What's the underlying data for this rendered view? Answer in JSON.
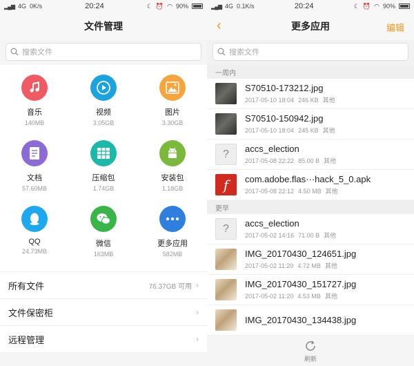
{
  "left": {
    "status": {
      "net": "4G",
      "speed": "0K/s",
      "time": "20:24",
      "battery": "90%"
    },
    "title": "文件管理",
    "search_placeholder": "搜索文件",
    "categories": [
      {
        "name": "音乐",
        "size": "140MB",
        "color": "#ef5a63",
        "icon": "music-icon"
      },
      {
        "name": "视频",
        "size": "3.05GB",
        "color": "#1ba3e0",
        "icon": "play-icon"
      },
      {
        "name": "图片",
        "size": "3.30GB",
        "color": "#f5a53c",
        "icon": "image-icon"
      },
      {
        "name": "文档",
        "size": "57.60MB",
        "color": "#8c6bd6",
        "icon": "document-icon"
      },
      {
        "name": "压缩包",
        "size": "1.74GB",
        "color": "#1cb8aa",
        "icon": "archive-icon"
      },
      {
        "name": "安装包",
        "size": "1.18GB",
        "color": "#7ab93c",
        "icon": "android-icon"
      },
      {
        "name": "QQ",
        "size": "24.73MB",
        "color": "#1ea8f0",
        "icon": "qq-icon"
      },
      {
        "name": "微信",
        "size": "163MB",
        "color": "#39b54a",
        "icon": "wechat-icon"
      },
      {
        "name": "更多应用",
        "size": "582MB",
        "color": "#2f7fe0",
        "icon": "more-icon"
      }
    ],
    "rows": [
      {
        "label": "所有文件",
        "info": "76.37GB 可用"
      },
      {
        "label": "文件保密柜",
        "info": ""
      },
      {
        "label": "远程管理",
        "info": ""
      }
    ]
  },
  "right": {
    "status": {
      "net": "4G",
      "speed": "0.1K/s",
      "time": "20:24",
      "battery": "90%"
    },
    "title": "更多应用",
    "edit": "编辑",
    "search_placeholder": "搜索文件",
    "sections": [
      {
        "label": "一周内",
        "files": [
          {
            "name": "S70510-173212.jpg",
            "date": "2017-05-10 18:04",
            "size": "246 KB",
            "tag": "其他",
            "thumb": "photo"
          },
          {
            "name": "S70510-150942.jpg",
            "date": "2017-05-10 18:04",
            "size": "245 KB",
            "tag": "其他",
            "thumb": "photo"
          },
          {
            "name": "accs_election",
            "date": "2017-05-08 22:22",
            "size": "85.00 B",
            "tag": "其他",
            "thumb": "unknown"
          },
          {
            "name": "com.adobe.flas···hack_5_0.apk",
            "date": "2017-05-08 22:12",
            "size": "4.50 MB",
            "tag": "其他",
            "thumb": "flash"
          }
        ]
      },
      {
        "label": "更早",
        "files": [
          {
            "name": "accs_election",
            "date": "2017-05-02 14:16",
            "size": "71.00 B",
            "tag": "其他",
            "thumb": "unknown"
          },
          {
            "name": "IMG_20170430_124651.jpg",
            "date": "2017-05-02 11:20",
            "size": "4.72 MB",
            "tag": "其他",
            "thumb": "photo2"
          },
          {
            "name": "IMG_20170430_151727.jpg",
            "date": "2017-05-02 11:20",
            "size": "4.53 MB",
            "tag": "其他",
            "thumb": "photo2"
          },
          {
            "name": "IMG_20170430_134438.jpg",
            "date": "",
            "size": "",
            "tag": "",
            "thumb": "photo2"
          }
        ]
      }
    ],
    "refresh_label": "刷新"
  },
  "colors": {
    "accent": "#f0961e"
  }
}
